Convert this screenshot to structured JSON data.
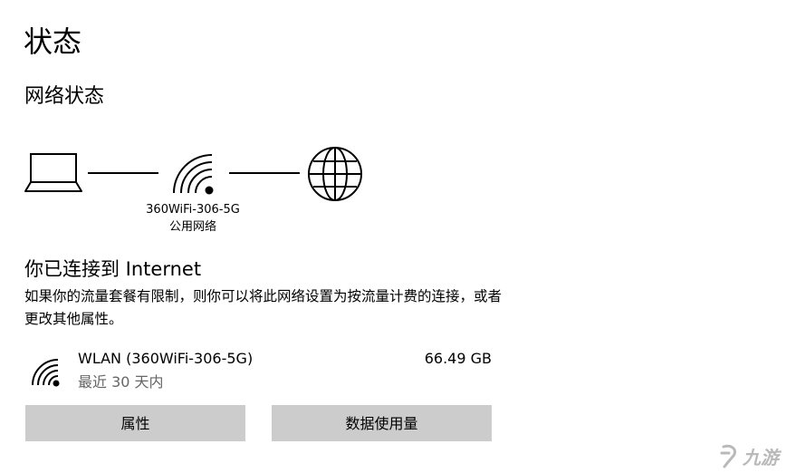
{
  "page": {
    "title": "状态",
    "section_title": "网络状态"
  },
  "network": {
    "ssid": "360WiFi-306-5G",
    "profile": "公用网络"
  },
  "connection": {
    "title": "你已连接到 Internet",
    "description": "如果你的流量套餐有限制，则你可以将此网络设置为按流量计费的连接，或者更改其他属性。"
  },
  "usage": {
    "adapter": "WLAN (360WiFi-306-5G)",
    "period": "最近 30 天内",
    "amount": "66.49 GB"
  },
  "buttons": {
    "properties": "属性",
    "data_usage": "数据使用量"
  },
  "watermark": {
    "text": "九游"
  },
  "icons": {
    "computer": "laptop-icon",
    "router": "wifi-icon",
    "internet": "globe-icon",
    "adapter": "wifi-signal-icon"
  }
}
